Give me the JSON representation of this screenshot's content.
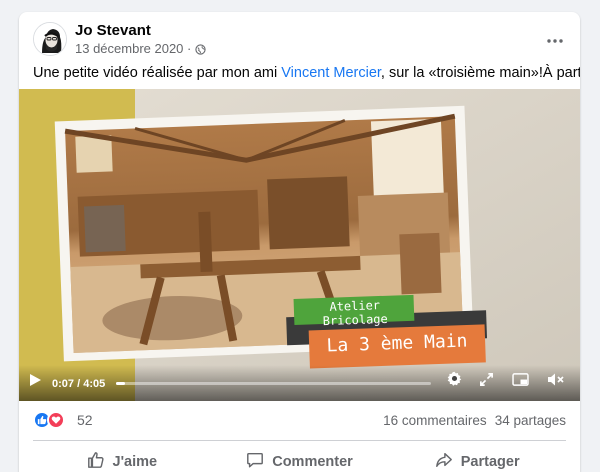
{
  "post": {
    "author": "Jo Stevant",
    "date": "13 décembre 2020 ·",
    "text_before": "Une petite vidéo réalisée par mon ami ",
    "text_link": "Vincent Mercier",
    "text_after": ", sur la «troisième main»!À partager!"
  },
  "video": {
    "title_line1": "Atelier Bricolage",
    "title_line2": "La 3 ème Main",
    "current_time": "0:07",
    "separator": "/",
    "duration": "4:05",
    "progress_fraction": 0.03
  },
  "stats": {
    "reaction_count": "52",
    "comments": "16 commentaires",
    "shares": "34 partages"
  },
  "actions": {
    "like": "J'aime",
    "comment": "Commenter",
    "share": "Partager"
  },
  "colors": {
    "link": "#1877f2",
    "like_blue": "#1877f2",
    "love_red": "#f33e58",
    "badge_green": "#4fa43c",
    "badge_orange": "#e57a3c"
  },
  "icons": [
    "globe-icon",
    "more-icon",
    "play-icon",
    "settings-icon",
    "fullscreen-icon",
    "pip-icon",
    "volume-muted-icon",
    "like-reaction-icon",
    "love-reaction-icon",
    "like-icon",
    "comment-icon",
    "share-icon"
  ]
}
